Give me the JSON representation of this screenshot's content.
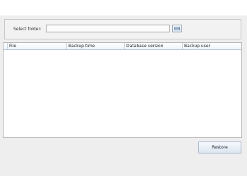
{
  "folder": {
    "label": "Select folder:",
    "value": "",
    "placeholder": ""
  },
  "grid": {
    "columns": [
      "File",
      "Backup time",
      "Database version",
      "Backup user"
    ],
    "rows": []
  },
  "actions": {
    "restore_label": "Restore"
  },
  "icons": {
    "browse": "folder-browse-icon"
  },
  "colors": {
    "background": "#eeeeee",
    "header_border": "#b9c7dc",
    "button_border": "#a8b8cd"
  }
}
